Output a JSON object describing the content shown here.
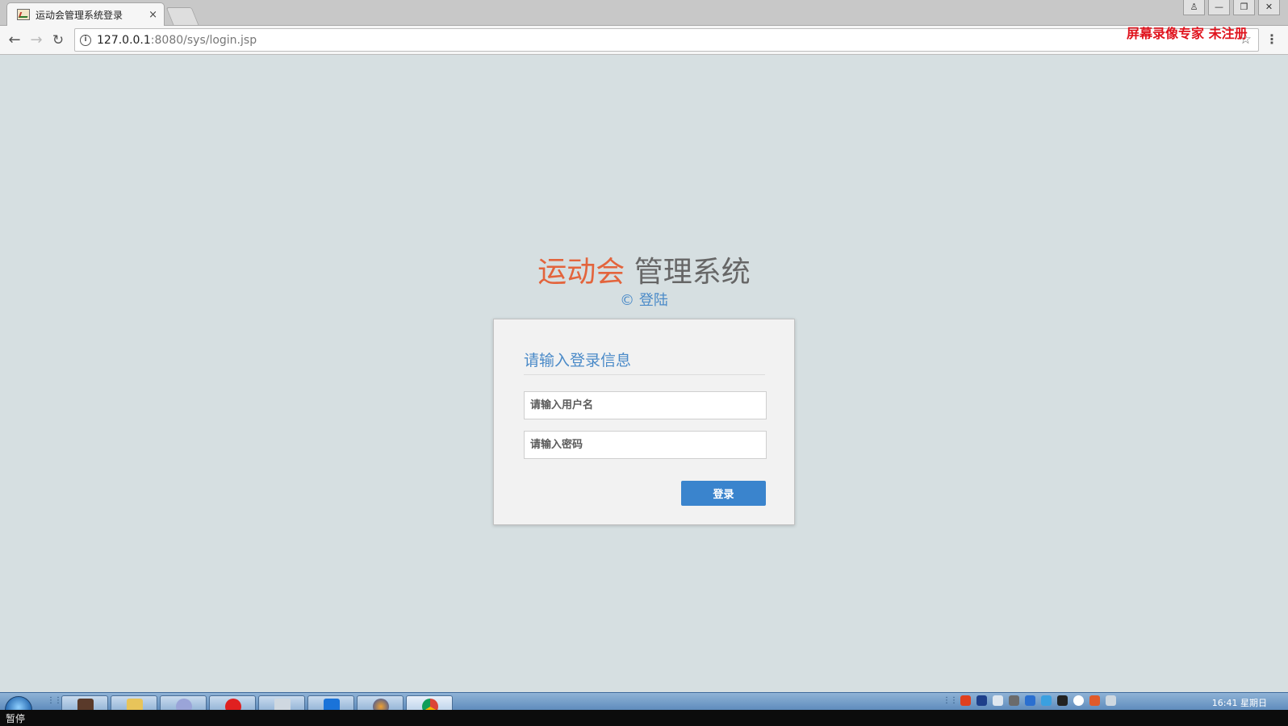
{
  "browser": {
    "tab_title": "运动会管理系统登录",
    "tab_close": "×",
    "window_controls": [
      "user-icon",
      "minimize-icon",
      "restore-icon",
      "close-icon"
    ],
    "address": {
      "host": "127.0.0.1",
      "rest": ":8080/sys/login.jsp"
    }
  },
  "watermark": "屏幕录像专家  未注册",
  "page": {
    "brand_accent": "运动会",
    "brand_rest": "管理系统",
    "subtitle": "© 登陆",
    "form": {
      "heading": "请输入登录信息",
      "username_placeholder": "请输入用户名",
      "password_placeholder": "请输入密码",
      "submit_label": "登录"
    }
  },
  "taskbar": {
    "apps": [
      "java-ide",
      "file-explorer",
      "ink-tool",
      "red-app",
      "notepad",
      "blue-app",
      "firefox",
      "chrome"
    ],
    "clock": "16:41 星期日"
  },
  "status": "暂停",
  "colors": {
    "accent": "#e3643c",
    "link_blue": "#4a8ac8",
    "button_blue": "#3a84cd",
    "watermark_red": "#e0141e"
  }
}
